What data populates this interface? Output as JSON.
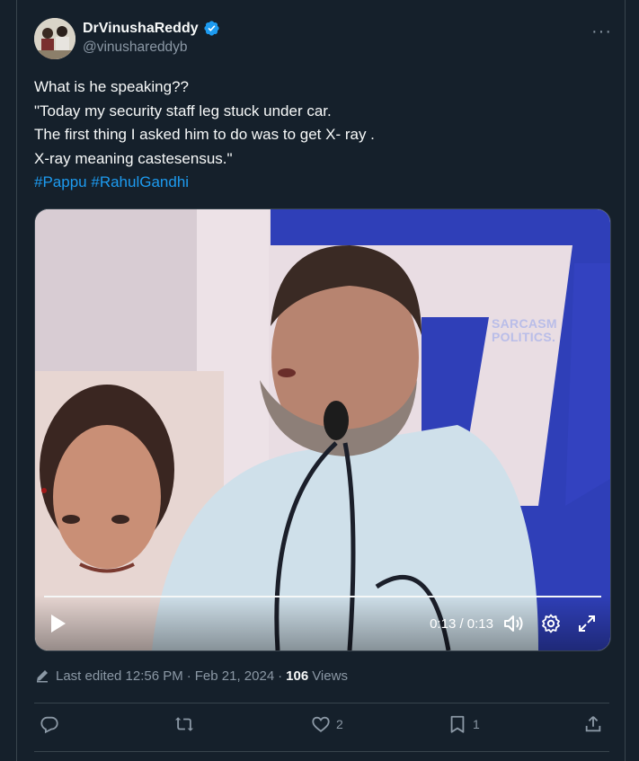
{
  "author": {
    "display_name": "DrVinushaReddy",
    "handle": "@vinushareddyb",
    "verified_icon": "verified-badge-icon",
    "more_label": "···"
  },
  "tweet": {
    "lines": [
      "What is he speaking??",
      "\"Today my security staff leg stuck under car.",
      "The first thing I asked him to do was to get X- ray .",
      "X-ray meaning castesensus.\""
    ],
    "hashtags": [
      "#Pappu",
      "#RahulGandhi"
    ]
  },
  "video": {
    "time": "0:13 / 0:13",
    "watermark_line1": "SARCASM",
    "watermark_line2": "POLITICS.",
    "progress": 1.0
  },
  "meta": {
    "edited": "Last edited 12:56 PM",
    "date": "Feb 21, 2024",
    "views_count": "106",
    "views_label": "Views",
    "separator": "·"
  },
  "actions": {
    "likes": "2",
    "bookmarks": "1"
  },
  "colors": {
    "background": "#15202b",
    "accent": "#1d9bf0",
    "muted": "#8b98a5",
    "border": "#38444d"
  }
}
